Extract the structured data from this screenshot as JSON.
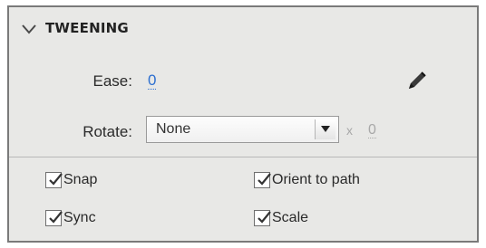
{
  "panel": {
    "section_title": "TWEENING"
  },
  "ease": {
    "label": "Ease:",
    "value": "0"
  },
  "rotate": {
    "label": "Rotate:",
    "selected": "None",
    "times_sign": "x",
    "times_value": "0"
  },
  "options": {
    "snap": {
      "label": "Snap",
      "checked": true
    },
    "orient_to_path": {
      "label": "Orient to path",
      "checked": true
    },
    "sync": {
      "label": "Sync",
      "checked": true
    },
    "scale": {
      "label": "Scale",
      "checked": true
    }
  },
  "colors": {
    "panel_bg": "#e8e8e6",
    "link_value": "#2d6fd0",
    "disabled_text": "#a8a8a8"
  },
  "icons": {
    "section_toggle": "chevron-down-icon",
    "ease_edit": "pencil-icon",
    "dropdown": "dropdown-arrow-icon",
    "checkbox": "checkmark-icon"
  }
}
